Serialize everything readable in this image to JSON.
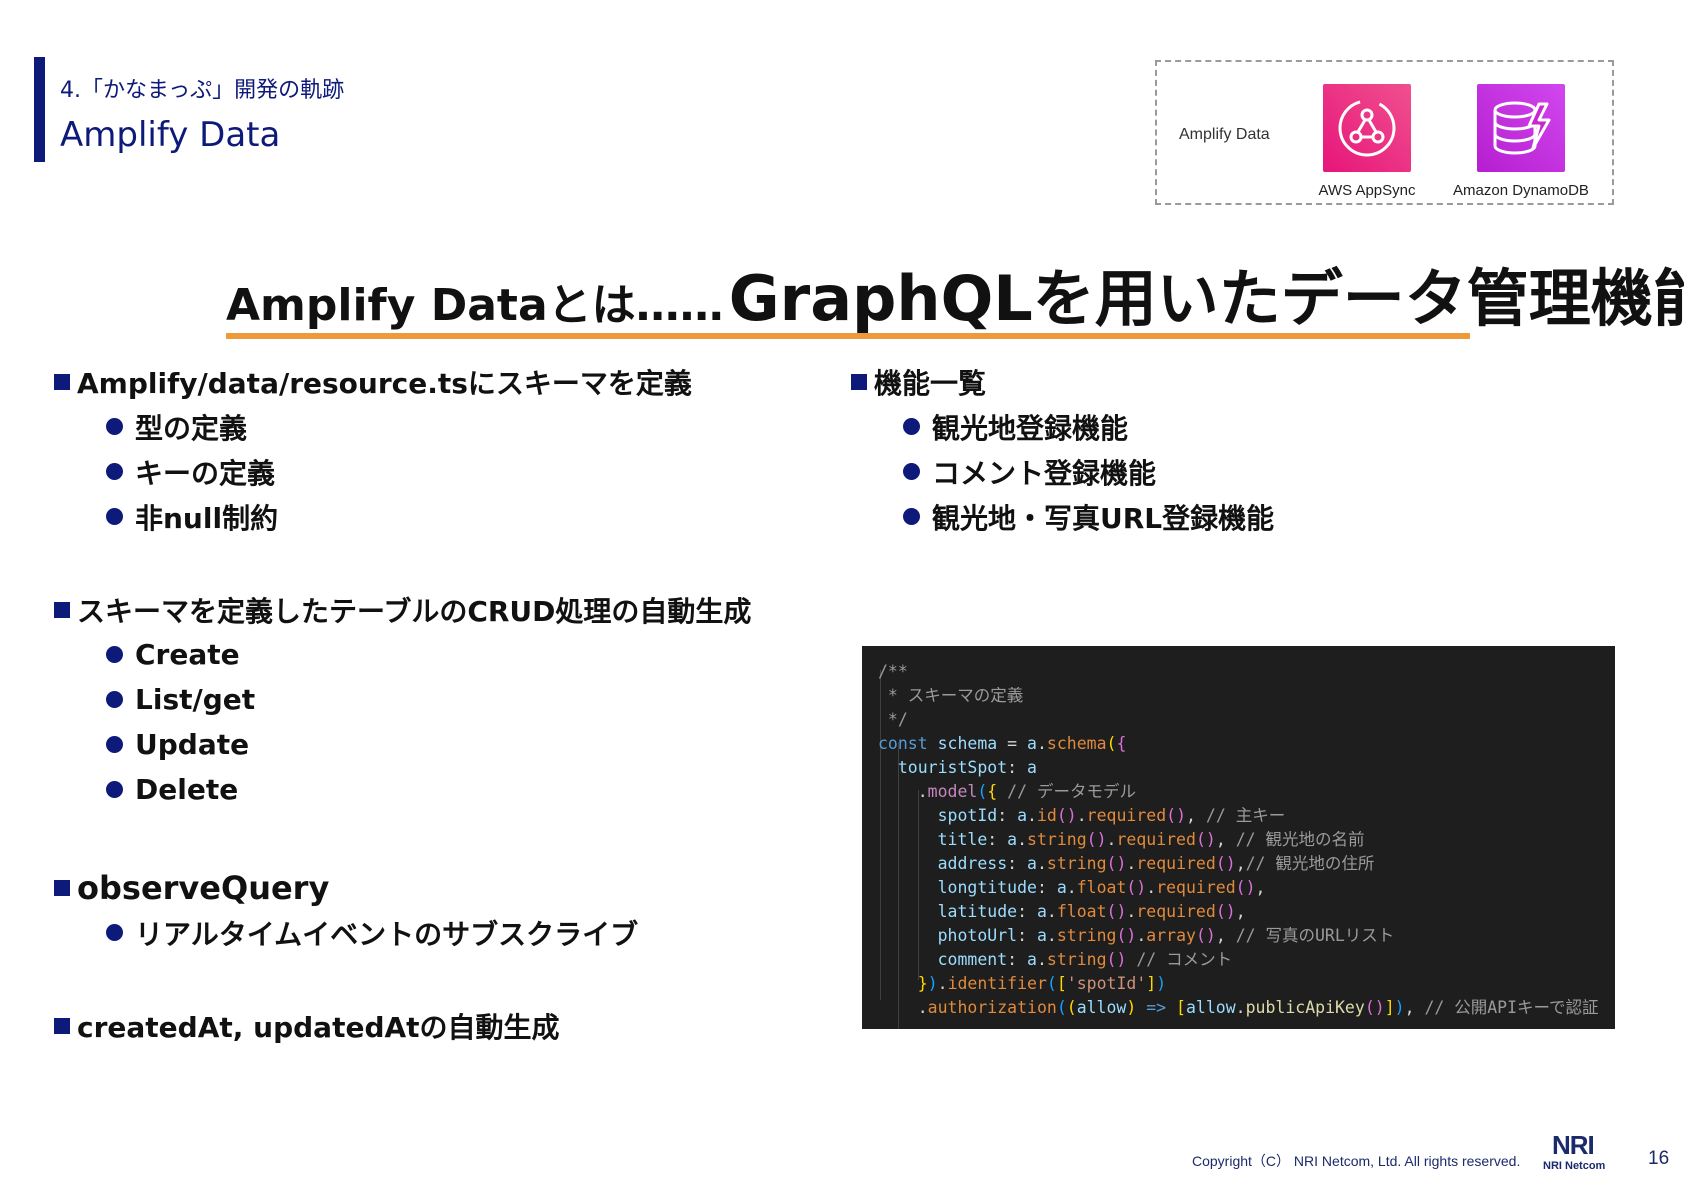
{
  "header": {
    "section_label": "4.「かなまっぷ」開発の軌跡",
    "title": "Amplify Data"
  },
  "diagram": {
    "label": "Amplify Data",
    "services": [
      {
        "name": "AWS AppSync",
        "icon": "appsync-icon",
        "color": "#e7157b"
      },
      {
        "name": "Amazon DynamoDB",
        "icon": "dynamodb-icon",
        "color": "#c925d1"
      }
    ]
  },
  "headline": {
    "lead": "Amplify Dataとは……",
    "main": "GraphQLを用いたデータ管理機能"
  },
  "left_sections": [
    {
      "heading": "Amplify/data/resource.tsにスキーマを定義",
      "items": [
        "型の定義",
        "キーの定義",
        "非null制約"
      ]
    },
    {
      "heading": "スキーマを定義したテーブルのCRUD処理の自動生成",
      "items": [
        "Create",
        "List/get",
        "Update",
        "Delete"
      ]
    },
    {
      "heading": "observeQuery",
      "items": [
        "リアルタイムイベントのサブスクライブ"
      ]
    },
    {
      "heading": "createdAt, updatedAtの自動生成",
      "items": []
    }
  ],
  "right_section": {
    "heading": "機能一覧",
    "items": [
      "観光地登録機能",
      "コメント登録機能",
      "観光地・写真URL登録機能"
    ]
  },
  "code": {
    "l1": "/**",
    "l2": " * スキーマの定義",
    "l3": " */",
    "l4_const": "const",
    "l4_schema": "schema",
    "l4_a": "a",
    "l4_fn": "schema",
    "l5_key": "touristSpot",
    "l5_a": "a",
    "l6_fn": "model",
    "l6_comment": "// データモデル",
    "fields": [
      {
        "key": "spotId",
        "fn1": "id",
        "fn2": "required",
        "tail": ",",
        "comment": "// 主キー"
      },
      {
        "key": "title",
        "fn1": "string",
        "fn2": "required",
        "tail": ",",
        "comment": "// 観光地の名前"
      },
      {
        "key": "address",
        "fn1": "string",
        "fn2": "required",
        "tail": ",",
        "comment": "// 観光地の住所"
      },
      {
        "key": "longtitude",
        "fn1": "float",
        "fn2": "required",
        "tail": ",",
        "comment": ""
      },
      {
        "key": "latitude",
        "fn1": "float",
        "fn2": "required",
        "tail": ",",
        "comment": ""
      },
      {
        "key": "photoUrl",
        "fn1": "string",
        "fn2": "array",
        "tail": ",",
        "comment": "// 写真のURLリスト"
      },
      {
        "key": "comment",
        "fn1": "string",
        "fn2": "",
        "tail": "",
        "comment": "// コメント"
      }
    ],
    "l14_fn": "identifier",
    "l14_str": "'spotId'",
    "l15_fn": "authorization",
    "l15_param": "allow",
    "l15_obj": "allow",
    "l15_call": "publicApiKey",
    "l15_comment": "// 公開APIキーで認証"
  },
  "footer": {
    "copyright": "Copyright（C） NRI Netcom, Ltd. All rights reserved.",
    "logo_text": "NRI",
    "logo_sub": "NRI Netcom",
    "page_number": "16"
  }
}
